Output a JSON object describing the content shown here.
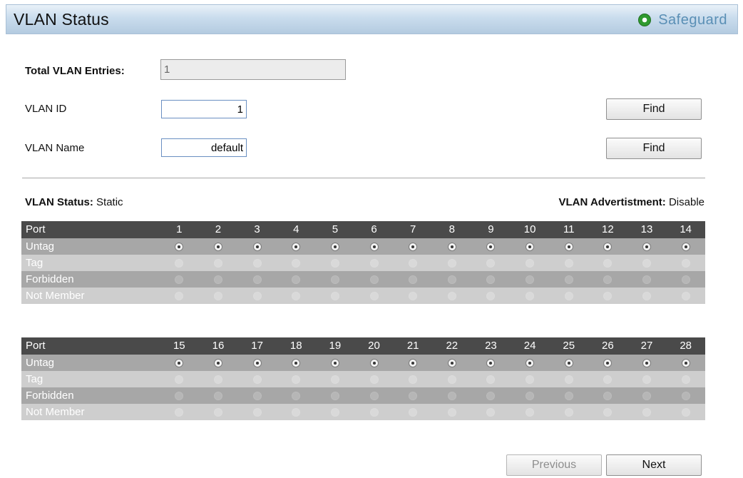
{
  "header": {
    "title": "VLAN Status",
    "safeguard_label": "Safeguard",
    "safeguard_icon": "status-led-icon",
    "safeguard_color": "#2f9a2f"
  },
  "form": {
    "total_label": "Total VLAN Entries:",
    "total_value": "1",
    "vlan_id_label": "VLAN ID",
    "vlan_id_value": "1",
    "vlan_name_label": "VLAN Name",
    "vlan_name_value": "default",
    "find_label": "Find"
  },
  "status": {
    "vlan_status_label": "VLAN Status:",
    "vlan_status_value": "Static",
    "advert_label": "VLAN Advertistment:",
    "advert_value": "Disable"
  },
  "tables": [
    {
      "port_label": "Port",
      "ports": [
        "1",
        "2",
        "3",
        "4",
        "5",
        "6",
        "7",
        "8",
        "9",
        "10",
        "11",
        "12",
        "13",
        "14"
      ],
      "rows": [
        "Untag",
        "Tag",
        "Forbidden",
        "Not Member"
      ],
      "selected_row": "Untag"
    },
    {
      "port_label": "Port",
      "ports": [
        "15",
        "16",
        "17",
        "18",
        "19",
        "20",
        "21",
        "22",
        "23",
        "24",
        "25",
        "26",
        "27",
        "28"
      ],
      "rows": [
        "Untag",
        "Tag",
        "Forbidden",
        "Not Member"
      ],
      "selected_row": "Untag"
    }
  ],
  "pager": {
    "previous_label": "Previous",
    "next_label": "Next"
  }
}
